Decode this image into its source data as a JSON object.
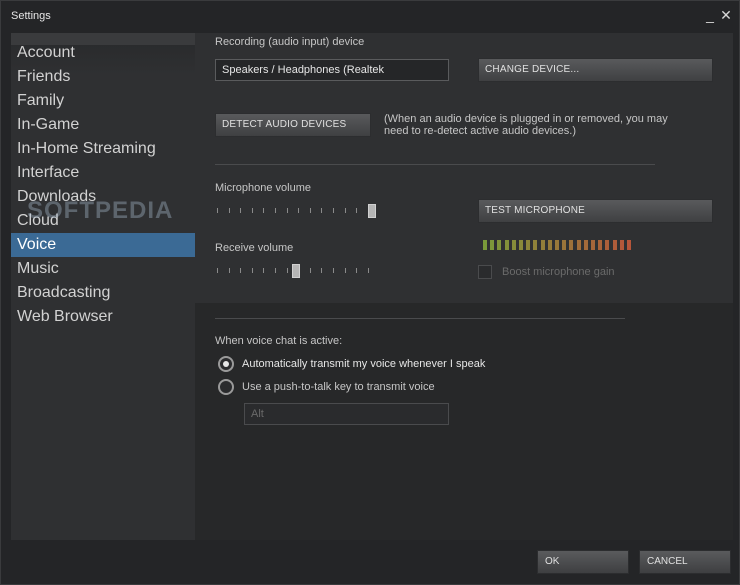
{
  "window": {
    "title": "Settings",
    "minimize_glyph": "_",
    "close_glyph": "✕"
  },
  "sidebar": {
    "items": [
      {
        "label": "Account"
      },
      {
        "label": "Friends"
      },
      {
        "label": "Family"
      },
      {
        "label": "In-Game"
      },
      {
        "label": "In-Home Streaming"
      },
      {
        "label": "Interface"
      },
      {
        "label": "Downloads"
      },
      {
        "label": "Cloud"
      },
      {
        "label": "Voice",
        "active": true
      },
      {
        "label": "Music"
      },
      {
        "label": "Broadcasting"
      },
      {
        "label": "Web Browser"
      }
    ],
    "watermark": "SOFTPEDIA"
  },
  "voice": {
    "recording_label": "Recording (audio input) device",
    "device_value": "Speakers / Headphones (Realtek",
    "change_device_button": "CHANGE DEVICE...",
    "detect_button": "DETECT AUDIO DEVICES",
    "detect_hint": "(When an audio device is plugged in or removed, you may need to re-detect active audio devices.)",
    "microphone_volume_label": "Microphone volume",
    "microphone_volume_level": 1.0,
    "test_microphone_button": "TEST MICROPHONE",
    "receive_volume_label": "Receive volume",
    "receive_volume_level": 0.5,
    "boost_label": "Boost microphone gain",
    "boost_checked": false,
    "voice_chat_heading": "When voice chat is active:",
    "radio_auto_label": "Automatically transmit my voice whenever I speak",
    "radio_auto_selected": true,
    "radio_ptt_label": "Use a push-to-talk key to transmit voice",
    "radio_ptt_selected": false,
    "ptt_key_value": "Alt"
  },
  "footer": {
    "ok_label": "OK",
    "cancel_label": "CANCEL"
  },
  "colors": {
    "accent": "#3b6a95",
    "meter_green": "#7a9a3a",
    "meter_red": "#b5553a"
  }
}
